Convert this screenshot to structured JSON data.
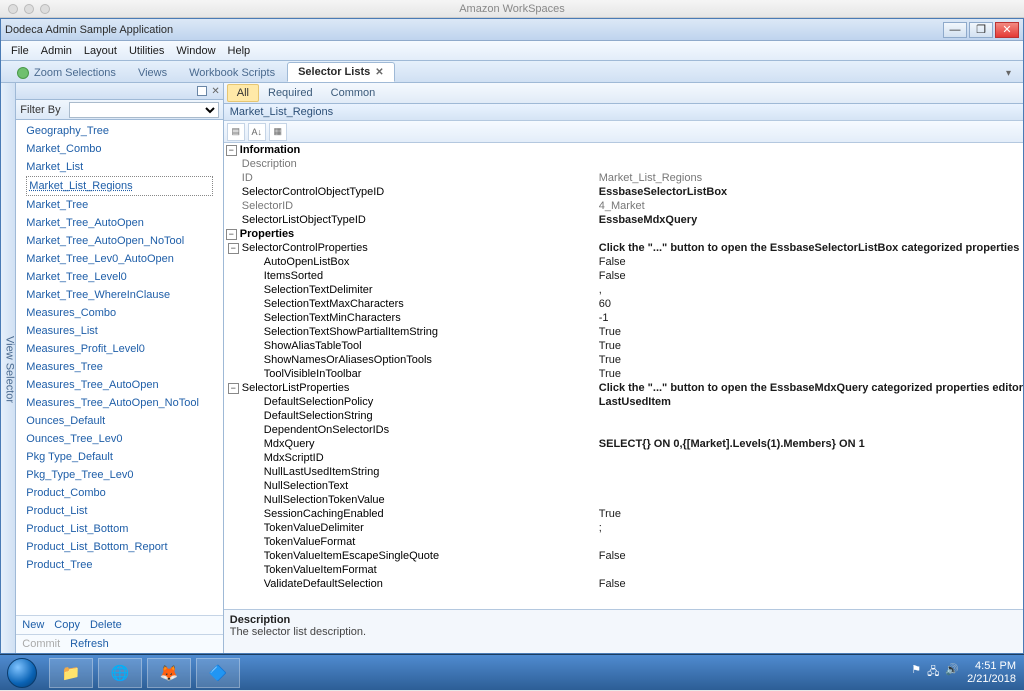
{
  "mac_title": "Amazon WorkSpaces",
  "app_title": "Dodeca Admin Sample Application",
  "menu": [
    "File",
    "Admin",
    "Layout",
    "Utilities",
    "Window",
    "Help"
  ],
  "tabs": [
    {
      "label": "Zoom Selections"
    },
    {
      "label": "Views"
    },
    {
      "label": "Workbook Scripts"
    },
    {
      "label": "Selector Lists",
      "active": true
    }
  ],
  "side_label": "View Selector",
  "filter_label": "Filter By",
  "selected_item": "Market_List_Regions",
  "sidebar_items": [
    "Geography_Tree",
    "Market_Combo",
    "Market_List",
    "Market_List_Regions",
    "Market_Tree",
    "Market_Tree_AutoOpen",
    "Market_Tree_AutoOpen_NoTool",
    "Market_Tree_Lev0_AutoOpen",
    "Market_Tree_Level0",
    "Market_Tree_WhereInClause",
    "Measures_Combo",
    "Measures_List",
    "Measures_Profit_Level0",
    "Measures_Tree",
    "Measures_Tree_AutoOpen",
    "Measures_Tree_AutoOpen_NoTool",
    "Ounces_Default",
    "Ounces_Tree_Lev0",
    "Pkg Type_Default",
    "Pkg_Type_Tree_Lev0",
    "Product_Combo",
    "Product_List",
    "Product_List_Bottom",
    "Product_List_Bottom_Report",
    "Product_Tree"
  ],
  "side_actions": [
    "New",
    "Copy",
    "Delete"
  ],
  "side_commit": [
    "Commit",
    "Refresh"
  ],
  "scope_tabs": [
    "All",
    "Required",
    "Common"
  ],
  "crumb": "Market_List_Regions",
  "grid": {
    "cat_information": "Information",
    "info": [
      {
        "k": "Description",
        "v": "",
        "gray": true
      },
      {
        "k": "ID",
        "v": "Market_List_Regions",
        "gray": true
      },
      {
        "k": "SelectorControlObjectTypeID",
        "v": "EssbaseSelectorListBox",
        "bold": true
      },
      {
        "k": "SelectorID",
        "v": "4_Market",
        "gray": true
      },
      {
        "k": "SelectorListObjectTypeID",
        "v": "EssbaseMdxQuery",
        "bold": true
      }
    ],
    "cat_properties": "Properties",
    "scp_label": "SelectorControlProperties",
    "scp_value": "Click the \"...\" button to open the EssbaseSelectorListBox categorized properties",
    "scp": [
      {
        "k": "AutoOpenListBox",
        "v": "False"
      },
      {
        "k": "ItemsSorted",
        "v": "False"
      },
      {
        "k": "SelectionTextDelimiter",
        "v": ","
      },
      {
        "k": "SelectionTextMaxCharacters",
        "v": "60"
      },
      {
        "k": "SelectionTextMinCharacters",
        "v": "-1"
      },
      {
        "k": "SelectionTextShowPartialItemString",
        "v": "True"
      },
      {
        "k": "ShowAliasTableTool",
        "v": "True"
      },
      {
        "k": "ShowNamesOrAliasesOptionTools",
        "v": "True"
      },
      {
        "k": "ToolVisibleInToolbar",
        "v": "True"
      }
    ],
    "slp_label": "SelectorListProperties",
    "slp_value": "Click the \"...\" button to open the EssbaseMdxQuery categorized properties editor",
    "slp": [
      {
        "k": "DefaultSelectionPolicy",
        "v": "LastUsedItem",
        "bold": true
      },
      {
        "k": "DefaultSelectionString",
        "v": ""
      },
      {
        "k": "DependentOnSelectorIDs",
        "v": ""
      },
      {
        "k": "MdxQuery",
        "v": "SELECT{} ON 0,{[Market].Levels(1).Members} ON 1",
        "bold": true
      },
      {
        "k": "MdxScriptID",
        "v": ""
      },
      {
        "k": "NullLastUsedItemString",
        "v": ""
      },
      {
        "k": "NullSelectionText",
        "v": ""
      },
      {
        "k": "NullSelectionTokenValue",
        "v": ""
      },
      {
        "k": "SessionCachingEnabled",
        "v": "True"
      },
      {
        "k": "TokenValueDelimiter",
        "v": ";"
      },
      {
        "k": "TokenValueFormat",
        "v": ""
      },
      {
        "k": "TokenValueItemEscapeSingleQuote",
        "v": "False"
      },
      {
        "k": "TokenValueItemFormat",
        "v": ""
      },
      {
        "k": "ValidateDefaultSelection",
        "v": "False"
      }
    ]
  },
  "desc": {
    "title": "Description",
    "text": "The selector list description."
  },
  "tray": {
    "time": "4:51 PM",
    "date": "2/21/2018"
  }
}
